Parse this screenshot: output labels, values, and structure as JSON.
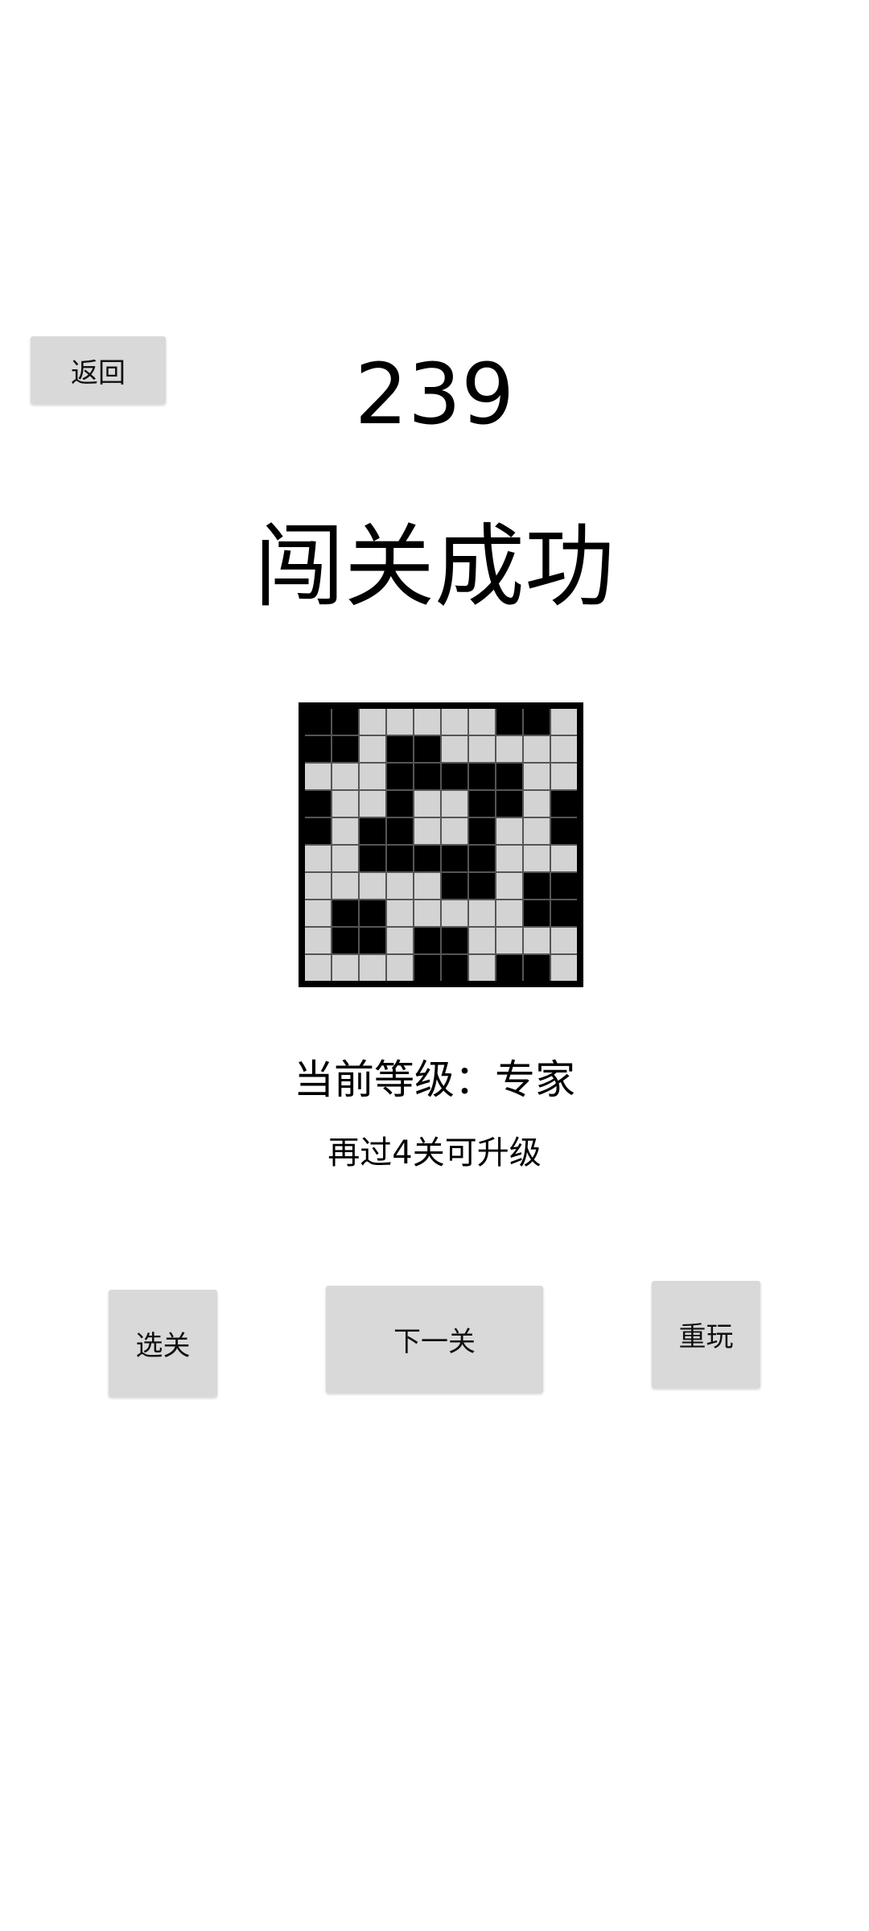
{
  "header": {
    "back_label": "返回",
    "level_number": "239"
  },
  "result": {
    "title": "闯关成功",
    "rank_text": "当前等级：专家",
    "upgrade_hint": "再过4关可升级"
  },
  "puzzle": {
    "rows": 10,
    "cols": 10,
    "cells": [
      [
        1,
        1,
        0,
        0,
        0,
        0,
        0,
        1,
        1,
        0
      ],
      [
        1,
        1,
        0,
        1,
        1,
        0,
        0,
        0,
        0,
        0
      ],
      [
        0,
        0,
        0,
        1,
        1,
        1,
        1,
        1,
        0,
        0
      ],
      [
        1,
        0,
        0,
        1,
        0,
        0,
        1,
        1,
        0,
        1
      ],
      [
        1,
        0,
        1,
        1,
        0,
        0,
        1,
        0,
        0,
        1
      ],
      [
        0,
        0,
        1,
        1,
        1,
        1,
        1,
        0,
        0,
        0
      ],
      [
        0,
        0,
        0,
        0,
        0,
        1,
        1,
        0,
        1,
        1
      ],
      [
        0,
        1,
        1,
        0,
        0,
        0,
        0,
        0,
        1,
        1
      ],
      [
        0,
        1,
        1,
        0,
        1,
        1,
        0,
        0,
        0,
        0
      ],
      [
        0,
        0,
        0,
        0,
        1,
        1,
        0,
        1,
        1,
        0
      ]
    ]
  },
  "actions": {
    "select_label": "选关",
    "next_label": "下一关",
    "replay_label": "重玩"
  }
}
